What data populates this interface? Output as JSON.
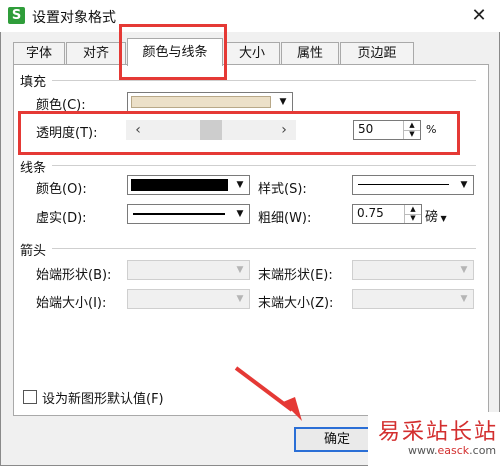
{
  "window": {
    "title": "设置对象格式",
    "app_icon_letter": "S",
    "close_glyph": "✕"
  },
  "tabs": [
    {
      "label": "字体"
    },
    {
      "label": "对齐"
    },
    {
      "label": "颜色与线条",
      "active": true
    },
    {
      "label": "大小"
    },
    {
      "label": "属性"
    },
    {
      "label": "页边距"
    }
  ],
  "fill": {
    "section_title": "填充",
    "color_label": "颜色(C):",
    "transparency_label": "透明度(T):",
    "transparency_value": "50",
    "transparency_unit": "%",
    "transparency_fraction": 0.5,
    "slider_left": "‹",
    "slider_right": "›"
  },
  "line": {
    "section_title": "线条",
    "color_label": "颜色(O):",
    "dash_label": "虚实(D):",
    "style_label": "样式(S):",
    "weight_label": "粗细(W):",
    "weight_value": "0.75",
    "weight_unit": "磅"
  },
  "arrows": {
    "section_title": "箭头",
    "begin_style_label": "始端形状(B):",
    "end_style_label": "末端形状(E):",
    "begin_size_label": "始端大小(I):",
    "end_size_label": "末端大小(Z):"
  },
  "default_checkbox_label": "设为新图形默认值(F)",
  "ok_label": "确定",
  "watermark": {
    "text": "易采站长站",
    "url_prefix": "www.",
    "url_brand": "easck",
    "url_suffix": ".com"
  },
  "colors": {
    "accent": "#2b6fd6",
    "highlight": "#e53935",
    "fill_swatch": "#ece0c8",
    "line_color": "#000000"
  }
}
